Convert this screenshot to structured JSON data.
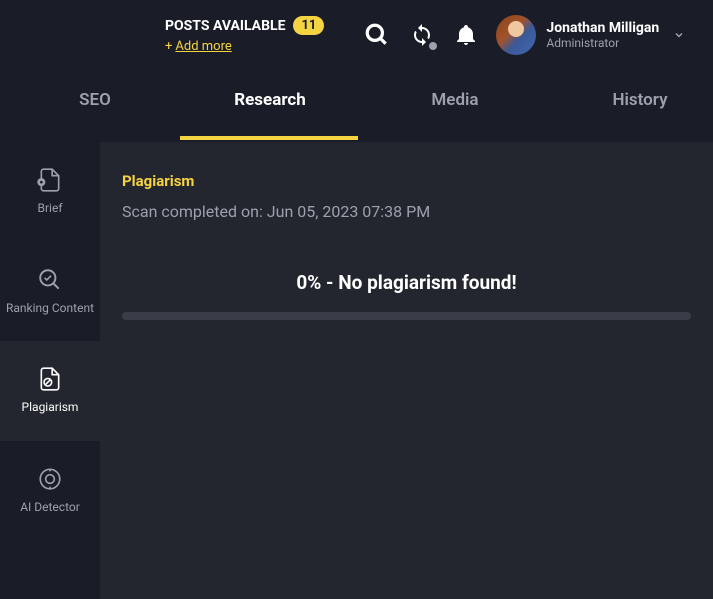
{
  "header": {
    "posts_label": "POSTS AVAILABLE",
    "posts_count": "11",
    "add_more_label": "Add more"
  },
  "user": {
    "name": "Jonathan Milligan",
    "role": "Administrator"
  },
  "tabs": {
    "seo": "SEO",
    "research": "Research",
    "media": "Media",
    "history": "History"
  },
  "sidebar": {
    "brief": "Brief",
    "ranking": "Ranking Content",
    "plagiarism": "Plagiarism",
    "ai_detector": "AI Detector"
  },
  "main": {
    "title": "Plagiarism",
    "scan_label": "Scan completed on: ",
    "scan_date": "Jun 05, 2023 07:38 PM",
    "result": "0% - No plagiarism found!"
  }
}
